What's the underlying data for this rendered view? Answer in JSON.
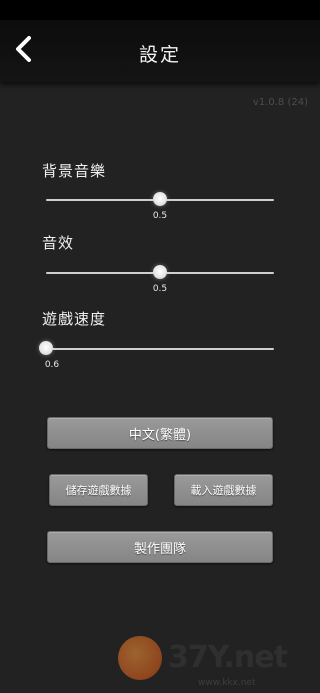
{
  "header": {
    "title": "設定",
    "back_icon": "chevron-left-icon"
  },
  "version": "v1.0.8 (24)",
  "settings": {
    "bgm": {
      "label": "背景音樂",
      "value": 0.5,
      "value_text": "0.5"
    },
    "sfx": {
      "label": "音效",
      "value": 0.5,
      "value_text": "0.5"
    },
    "game_speed": {
      "label": "遊戲速度",
      "value": 0.6,
      "value_text": "0.6",
      "min": 0.6,
      "max": 1.0
    }
  },
  "buttons": {
    "language": "中文(繁體)",
    "save_data": "儲存遊戲數據",
    "load_data": "載入遊戲數據",
    "credits": "製作團隊"
  },
  "watermark": {
    "brand": "37Y.net",
    "url": "www.kkx.net"
  },
  "colors": {
    "background": "#222222",
    "header": "#111111",
    "button": "#8f8f8f",
    "accent_logo": "#e8621a"
  }
}
